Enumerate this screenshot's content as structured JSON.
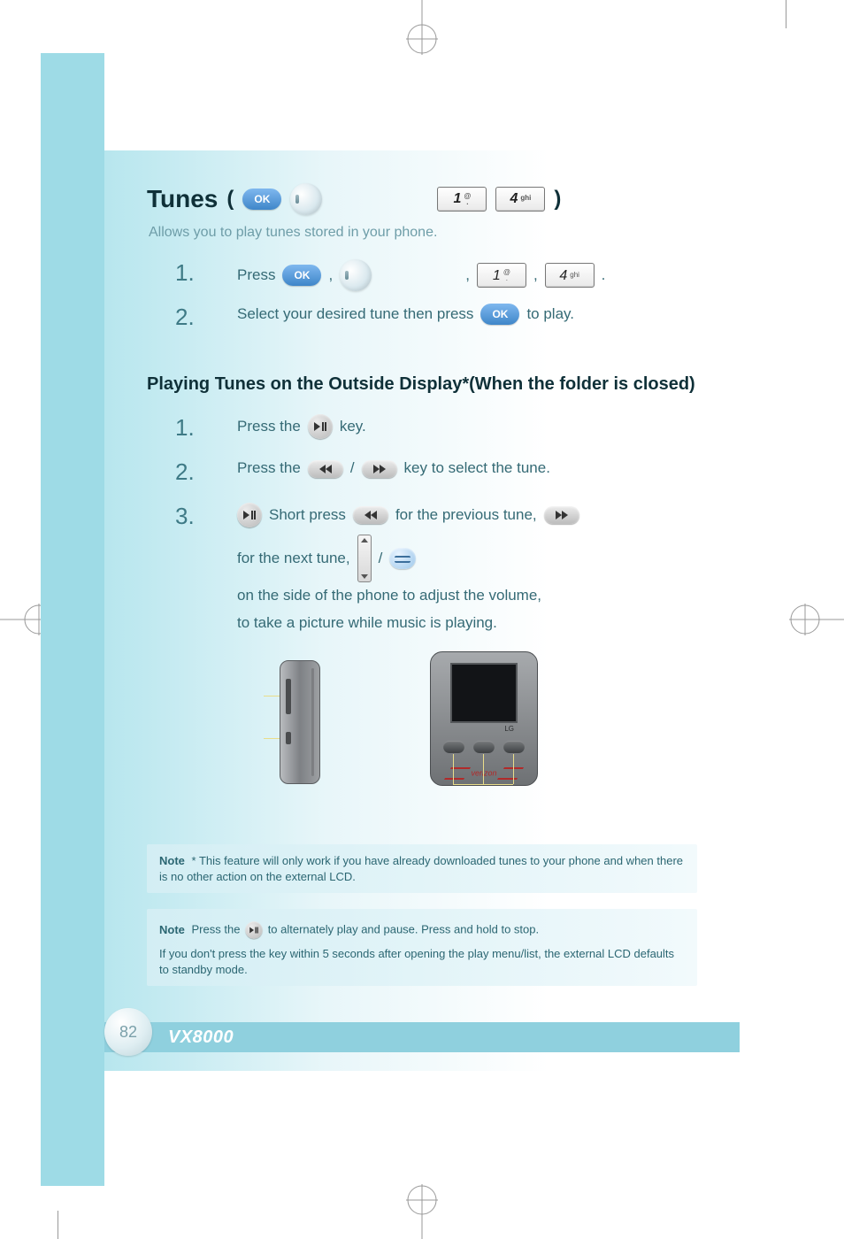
{
  "header": {
    "title": "Tunes",
    "open_paren": "(",
    "close_paren": ")",
    "ok_label": "OK",
    "key1_main": "1",
    "key1_sub_top": "@",
    "key1_sub_bot": ".",
    "key4_main": "4",
    "key4_sub": "ghi"
  },
  "intro": {
    "line": "Allows you to play tunes stored in your phone."
  },
  "steps_top": {
    "s1_num": "1.",
    "s1_a": "Press",
    "s1_b": ",",
    "s1_c": ",",
    "s1_d": ",",
    "s1_e": ".",
    "s2_num": "2.",
    "s2_a": "Select your desired tune then press",
    "s2_b": "to play."
  },
  "subhead": "Playing Tunes on the Outside Display*(When the folder is closed)",
  "outside_steps": {
    "s1_num": "1.",
    "s1_text": "Press the",
    "s1_tail": "key.",
    "s2_num": "2.",
    "s2_text": "Press the",
    "s2_mid": "/",
    "s2_tail": "key to select the tune.",
    "s3_num": "3.",
    "s3_pre": "Short press",
    "s3_post_a": "for the previous tune,",
    "s3_post_b": "for the next tune,",
    "s3_post_c": "/",
    "s3_post_d": "on the side of the phone to adjust the volume,",
    "s3_post_e": "to take a picture while music is playing."
  },
  "note1": {
    "title": "Note",
    "body": "* This feature will only work if you have already downloaded tunes to your phone and when there is no other action on the external LCD."
  },
  "note2": {
    "title": "Note",
    "body_a": "Press the",
    "body_b": "to alternately play and pause. Press and hold to stop.",
    "body_c": "If you don't press the key within 5 seconds after opening the play menu/list, the external LCD defaults to standby mode."
  },
  "footer": {
    "page_number": "82",
    "model": "VX8000"
  },
  "labels": {
    "play_pause": "play-pause",
    "rewind": "rewind",
    "forward": "forward",
    "volume": "volume",
    "camera": "camera-key",
    "lg": "LG",
    "verizon": "verizon"
  }
}
